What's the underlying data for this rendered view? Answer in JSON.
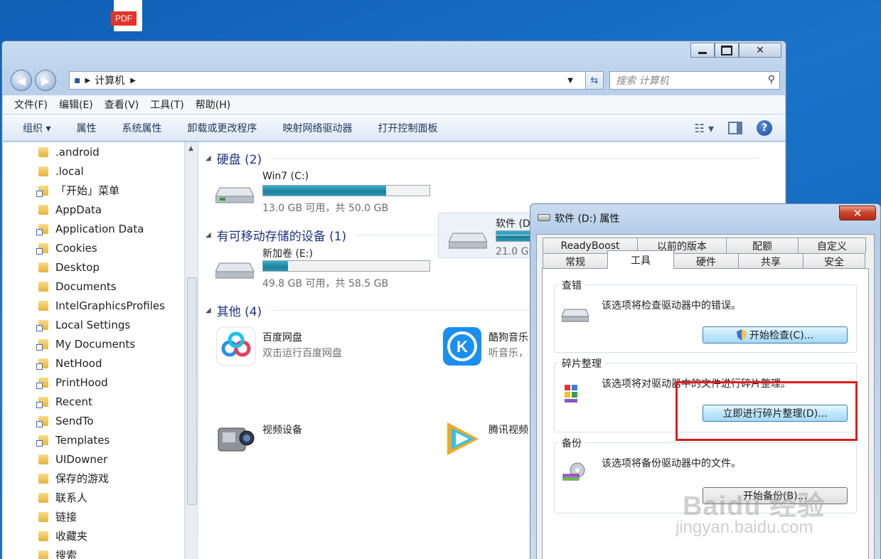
{
  "desktop": {
    "pdf_label": "PDF"
  },
  "explorer": {
    "address": "计算机",
    "search_placeholder": "搜索 计算机",
    "menu": [
      "文件(F)",
      "编辑(E)",
      "查看(V)",
      "工具(T)",
      "帮助(H)"
    ],
    "toolbar": [
      "组织 ▾",
      "属性",
      "系统属性",
      "卸载或更改程序",
      "映射网络驱动器",
      "打开控制面板"
    ],
    "nav": [
      {
        "label": ".android",
        "short": false
      },
      {
        "label": ".local",
        "short": false
      },
      {
        "label": "「开始」菜单",
        "short": true
      },
      {
        "label": "AppData",
        "short": false
      },
      {
        "label": "Application Data",
        "short": true
      },
      {
        "label": "Cookies",
        "short": true
      },
      {
        "label": "Desktop",
        "short": false
      },
      {
        "label": "Documents",
        "short": false
      },
      {
        "label": "IntelGraphicsProfiles",
        "short": false
      },
      {
        "label": "Local Settings",
        "short": true
      },
      {
        "label": "My Documents",
        "short": true
      },
      {
        "label": "NetHood",
        "short": true
      },
      {
        "label": "PrintHood",
        "short": true
      },
      {
        "label": "Recent",
        "short": true
      },
      {
        "label": "SendTo",
        "short": true
      },
      {
        "label": "Templates",
        "short": true
      },
      {
        "label": "UIDowner",
        "short": false
      },
      {
        "label": "保存的游戏",
        "short": false
      },
      {
        "label": "联系人",
        "short": false
      },
      {
        "label": "链接",
        "short": false
      },
      {
        "label": "收藏夹",
        "short": false
      },
      {
        "label": "搜索",
        "short": false
      }
    ],
    "groups": {
      "hdd": "硬盘 (2)",
      "removable": "有可移动存储的设备 (1)",
      "other": "其他 (4)"
    },
    "drives": [
      {
        "name": "Win7 (C:)",
        "cap": "13.0 GB 可用，共 50.0 GB",
        "used": 0.74
      },
      {
        "name": "软件 (D:)",
        "cap": "21.0 GB",
        "used": 0.66
      },
      {
        "name": "新加卷 (E:)",
        "cap": "49.8 GB 可用，共 58.5 GB",
        "used": 0.15
      }
    ],
    "apps": [
      {
        "name": "百度网盘",
        "desc": "双击运行百度网盘"
      },
      {
        "name": "酷狗音乐",
        "desc": "听音乐，"
      },
      {
        "name": "视频设备",
        "desc": ""
      },
      {
        "name": "腾讯视频",
        "desc": ""
      }
    ]
  },
  "dialog": {
    "title": "软件 (D:) 属性",
    "tabs_top": [
      "ReadyBoost",
      "以前的版本",
      "配额",
      "自定义"
    ],
    "tabs_bottom": [
      "常规",
      "工具",
      "硬件",
      "共享",
      "安全"
    ],
    "active_tab": "工具",
    "sections": [
      {
        "legend": "查错",
        "text": "该选项将检查驱动器中的错误。",
        "button": "开始检查(C)..."
      },
      {
        "legend": "碎片整理",
        "text": "该选项将对驱动器中的文件进行碎片整理。",
        "button": "立即进行碎片整理(D)..."
      },
      {
        "legend": "备份",
        "text": "该选项将备份驱动器中的文件。",
        "button": "开始备份(B)..."
      }
    ]
  },
  "watermark": {
    "line1": "Baidu 经验",
    "line2": "jingyan.baidu.com"
  }
}
